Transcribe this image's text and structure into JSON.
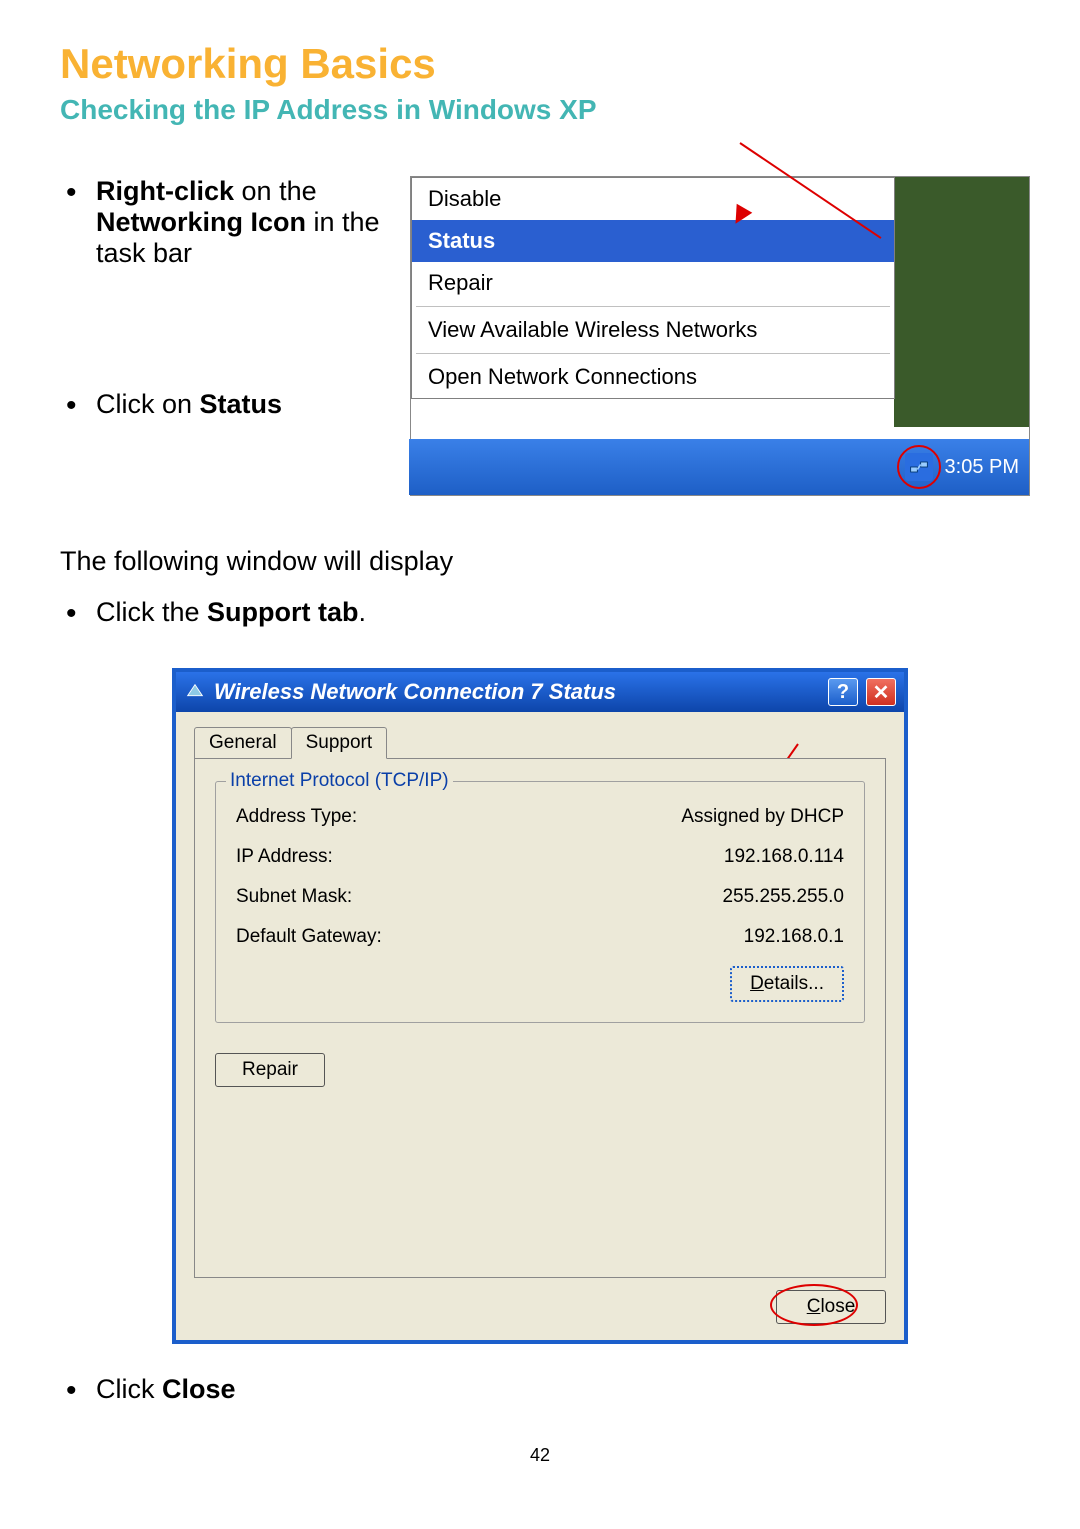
{
  "page": {
    "title": "Networking Basics",
    "subtitle": "Checking the IP Address in Windows XP",
    "number": "42"
  },
  "instructions": {
    "step1_bold1": "Right-click",
    "step1_mid": " on the ",
    "step1_bold2": "Networking Icon",
    "step1_tail": " in the task bar",
    "step2_pre": "Click on ",
    "step2_bold": "Status",
    "mid": "The following window will display",
    "step3_pre": "Click the ",
    "step3_bold": "Support tab",
    "step3_tail": ".",
    "step4_pre": "Click ",
    "step4_bold": "Close"
  },
  "context_menu": {
    "items": {
      "disable": "Disable",
      "status": "Status",
      "repair": "Repair",
      "view_networks": "View Available Wireless Networks",
      "open_connections": "Open Network Connections"
    },
    "clock": "3:05 PM"
  },
  "dialog": {
    "title": "Wireless Network Connection 7 Status",
    "tabs": {
      "general": "General",
      "support": "Support"
    },
    "fieldset_legend": "Internet Protocol (TCP/IP)",
    "rows": {
      "address_type_label": "Address Type:",
      "address_type_value": "Assigned by DHCP",
      "ip_label": "IP Address:",
      "ip_value": "192.168.0.114",
      "subnet_label": "Subnet Mask:",
      "subnet_value": "255.255.255.0",
      "gateway_label": "Default Gateway:",
      "gateway_value": "192.168.0.1"
    },
    "buttons": {
      "details": "Details...",
      "repair": "Repair",
      "close": "Close"
    }
  }
}
